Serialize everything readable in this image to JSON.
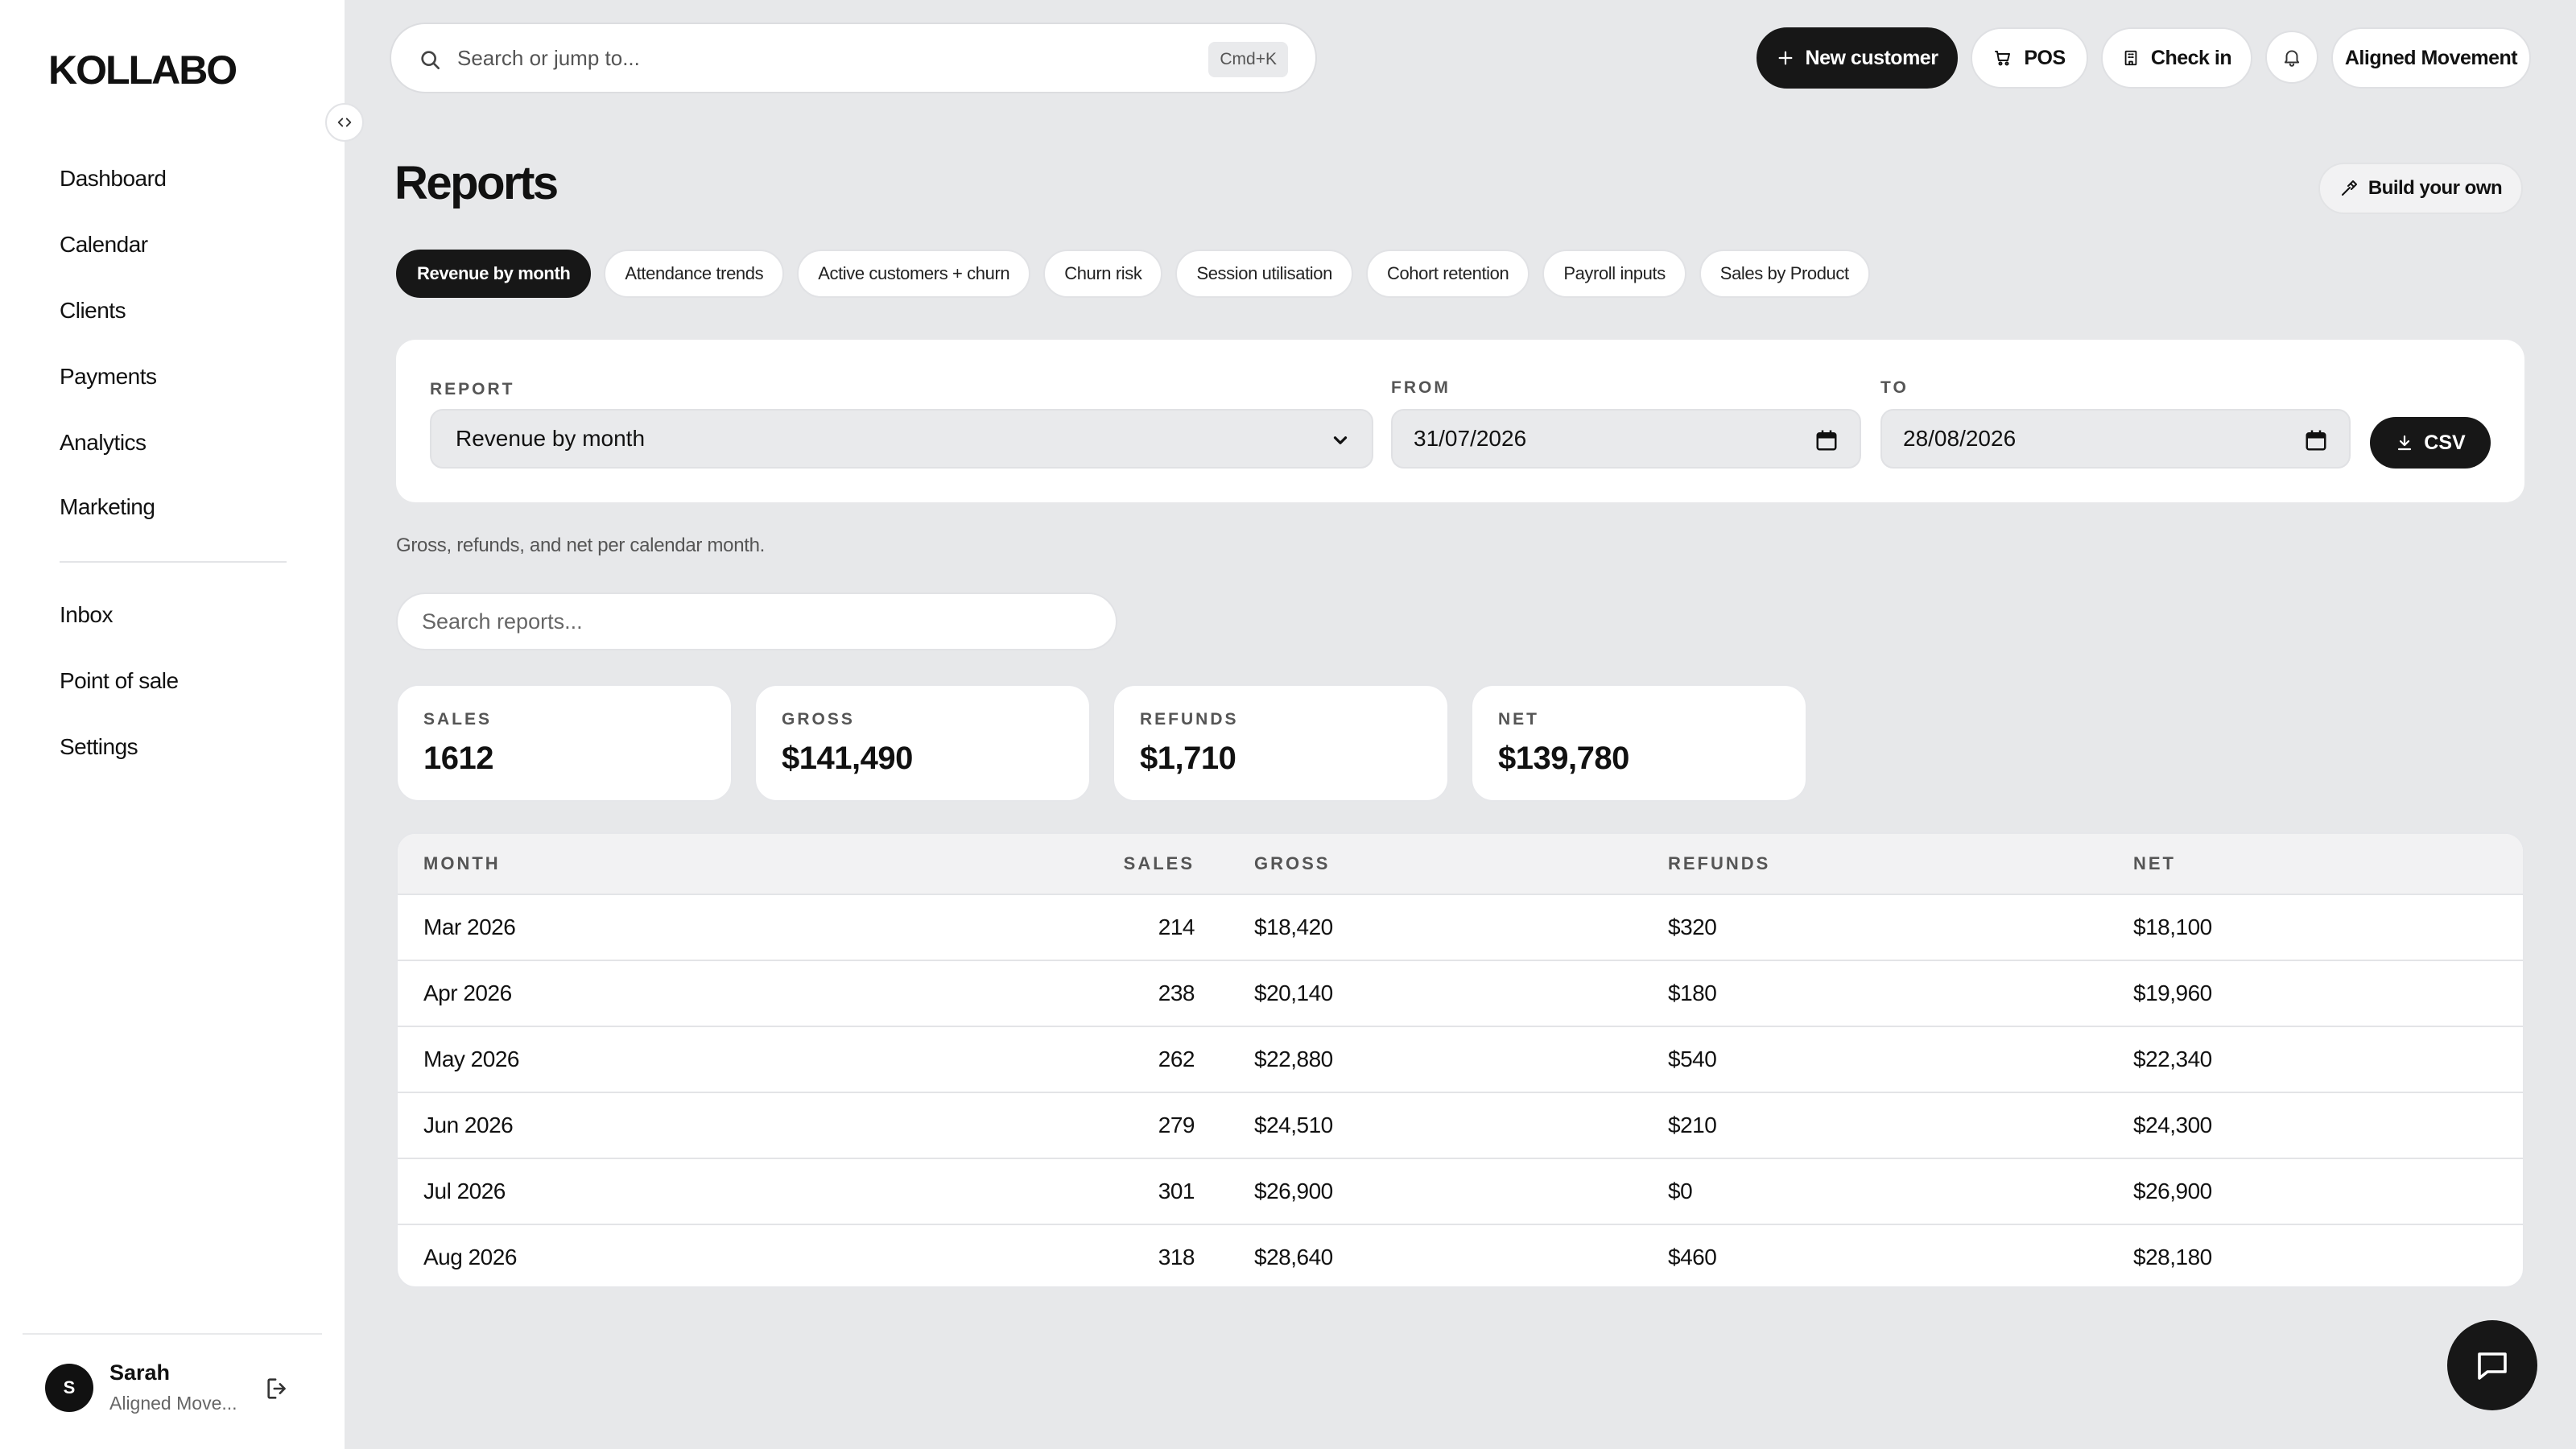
{
  "app": {
    "logo": "KOLLABO"
  },
  "sidebar": {
    "items": [
      {
        "label": "Dashboard"
      },
      {
        "label": "Calendar"
      },
      {
        "label": "Clients"
      },
      {
        "label": "Payments"
      },
      {
        "label": "Analytics"
      },
      {
        "label": "Marketing"
      }
    ],
    "secondary": [
      {
        "label": "Inbox"
      },
      {
        "label": "Point of sale"
      },
      {
        "label": "Settings"
      }
    ],
    "user": {
      "initial": "S",
      "name": "Sarah",
      "org": "Aligned Move..."
    }
  },
  "topbar": {
    "search_placeholder": "Search or jump to...",
    "shortcut": "Cmd+K",
    "new_customer": "New customer",
    "pos": "POS",
    "check_in": "Check in",
    "workspace": "Aligned Movement"
  },
  "page": {
    "title": "Reports",
    "build_button": "Build your own",
    "tabs": [
      {
        "label": "Revenue by month",
        "active": true
      },
      {
        "label": "Attendance trends"
      },
      {
        "label": "Active customers + churn"
      },
      {
        "label": "Churn risk"
      },
      {
        "label": "Session utilisation"
      },
      {
        "label": "Cohort retention"
      },
      {
        "label": "Payroll inputs"
      },
      {
        "label": "Sales by Product"
      }
    ],
    "filters": {
      "report_label": "REPORT",
      "report_value": "Revenue by month",
      "from_label": "FROM",
      "from_value": "31/07/2026",
      "to_label": "TO",
      "to_value": "28/08/2026",
      "csv_label": "CSV"
    },
    "description": "Gross, refunds, and net per calendar month.",
    "search_placeholder": "Search reports...",
    "stats": [
      {
        "label": "SALES",
        "value": "1612"
      },
      {
        "label": "GROSS",
        "value": "$141,490"
      },
      {
        "label": "REFUNDS",
        "value": "$1,710"
      },
      {
        "label": "NET",
        "value": "$139,780"
      }
    ],
    "table": {
      "headers": {
        "month": "MONTH",
        "sales": "SALES",
        "gross": "GROSS",
        "refunds": "REFUNDS",
        "net": "NET"
      },
      "rows": [
        {
          "month": "Mar 2026",
          "sales": "214",
          "gross": "$18,420",
          "refunds": "$320",
          "net": "$18,100"
        },
        {
          "month": "Apr 2026",
          "sales": "238",
          "gross": "$20,140",
          "refunds": "$180",
          "net": "$19,960"
        },
        {
          "month": "May 2026",
          "sales": "262",
          "gross": "$22,880",
          "refunds": "$540",
          "net": "$22,340"
        },
        {
          "month": "Jun 2026",
          "sales": "279",
          "gross": "$24,510",
          "refunds": "$210",
          "net": "$24,300"
        },
        {
          "month": "Jul 2026",
          "sales": "301",
          "gross": "$26,900",
          "refunds": "$0",
          "net": "$26,900"
        },
        {
          "month": "Aug 2026",
          "sales": "318",
          "gross": "$28,640",
          "refunds": "$460",
          "net": "$28,180"
        }
      ]
    }
  },
  "icons": {
    "search": "search-icon",
    "plus": "plus-icon",
    "cart": "cart-icon",
    "building": "building-icon",
    "bell": "bell-icon",
    "hammer": "hammer-icon",
    "download": "download-icon",
    "calendar": "calendar-icon",
    "chevron": "chevron-down-icon",
    "logout": "logout-icon",
    "chat": "chat-icon",
    "collapse": "collapse-icon"
  },
  "colors": {
    "accent": "#171717",
    "background": "#e7e8ea",
    "surface": "#ffffff"
  }
}
